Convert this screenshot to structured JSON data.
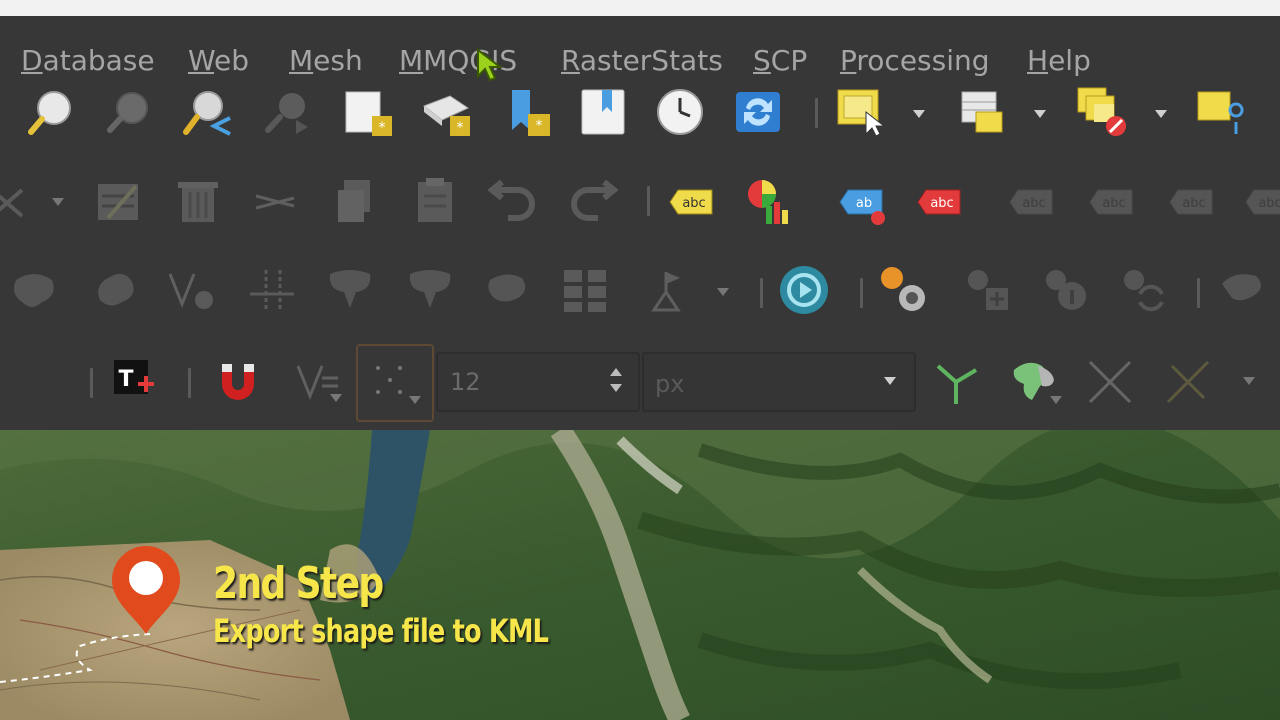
{
  "menubar": {
    "items": [
      {
        "label": "Database"
      },
      {
        "label": "Web"
      },
      {
        "label": "Mesh"
      },
      {
        "label": "MMQGIS"
      },
      {
        "label": "RasterStats"
      },
      {
        "label": "SCP"
      },
      {
        "label": "Processing"
      },
      {
        "label": "Help"
      }
    ]
  },
  "toolbar": {
    "symbol_size_value": "12",
    "symbol_unit": "px"
  },
  "overlay": {
    "title": "2nd Step",
    "subtitle": "Export shape file to KML"
  },
  "colors": {
    "toolbar_bg": "#373737",
    "menu_text": "#a5a5a5",
    "overlay_text": "#f6e64a",
    "pin": "#e04a1c"
  }
}
